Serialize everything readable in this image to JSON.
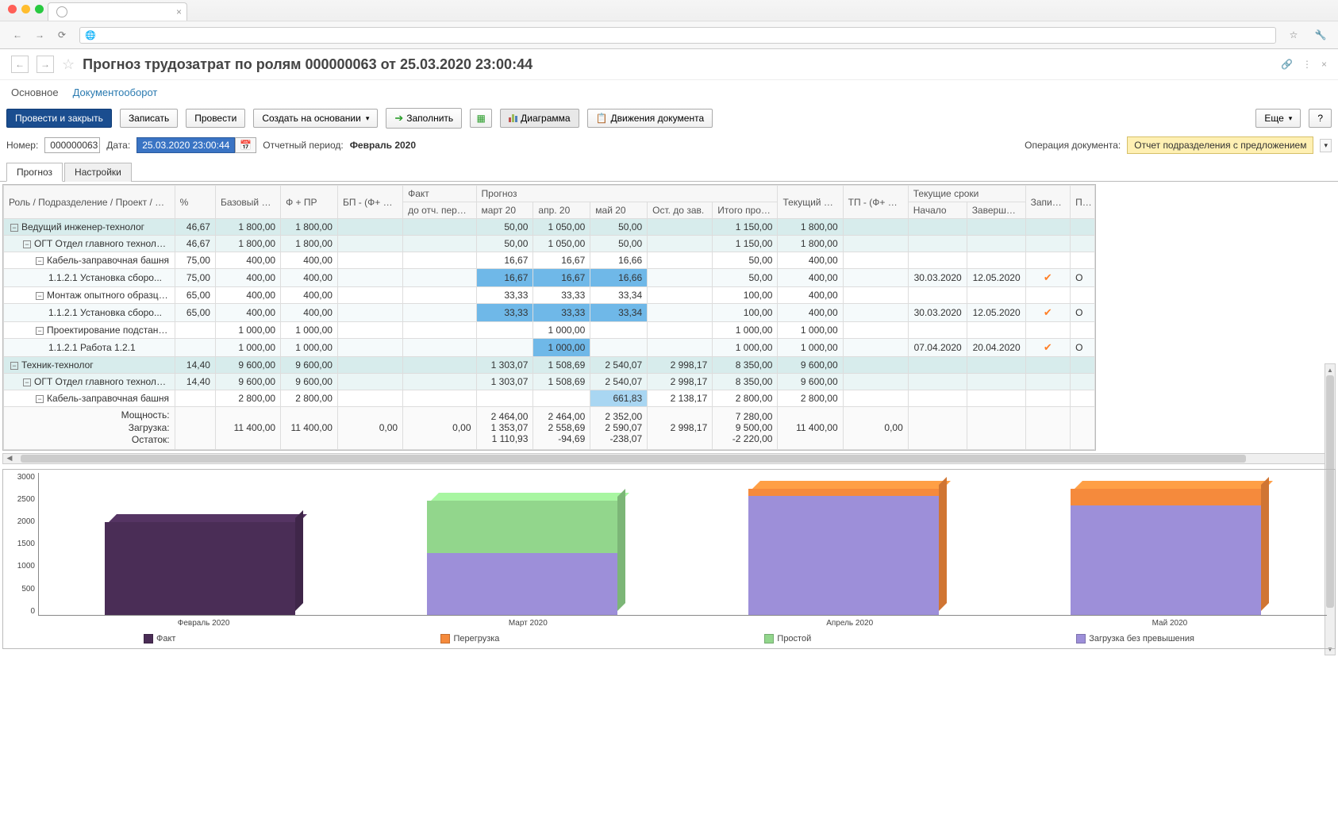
{
  "header": {
    "title": "Прогноз трудозатрат по ролям 000000063 от 25.03.2020 23:00:44"
  },
  "subnav": {
    "main": "Основное",
    "docs": "Документооборот"
  },
  "toolbar": {
    "post_close": "Провести и закрыть",
    "write": "Записать",
    "post": "Провести",
    "create_based": "Создать на основании",
    "fill": "Заполнить",
    "diagram": "Диаграмма",
    "movements": "Движения документа",
    "more": "Еще",
    "help": "?"
  },
  "fields": {
    "number_label": "Номер:",
    "number": "000000063",
    "date_label": "Дата:",
    "date": "25.03.2020 23:00:44",
    "period_label": "Отчетный период:",
    "period": "Февраль 2020",
    "operation_label": "Операция документа:",
    "operation": "Отчет подразделения с предложением"
  },
  "tabs": {
    "forecast": "Прогноз",
    "settings": "Настройки"
  },
  "columns": {
    "role": "Роль / Подразделение / Проект / Задача",
    "percent": "%",
    "base_plan": "Базовый план",
    "f_pr": "Ф + ПР",
    "bp_fpr": "БП - (Ф+ ПР)",
    "fact": "Факт",
    "fact_sub": "до отч. периода",
    "forecast_group": "Прогноз",
    "mar": "март 20",
    "apr": "апр. 20",
    "may": "май 20",
    "rest": "Ост. до зав.",
    "total_forecast": "Итого прогноз",
    "current_plan": "Текущий план",
    "tp_fpr": "ТП - (Ф+ ПР)",
    "dates_group": "Текущие сроки",
    "start": "Начало",
    "end": "Завершение",
    "write_col": "Записать",
    "pr_col": "Пр тр"
  },
  "rows": [
    {
      "lvl": 0,
      "name": "Ведущий инженер-технолог",
      "pct": "46,67",
      "bp": "1 800,00",
      "fpr": "1 800,00",
      "mar": "50,00",
      "apr": "1 050,00",
      "may": "50,00",
      "total": "1 150,00",
      "cur": "1 800,00"
    },
    {
      "lvl": 1,
      "name": "ОГТ Отдел главного технолога",
      "pct": "46,67",
      "bp": "1 800,00",
      "fpr": "1 800,00",
      "mar": "50,00",
      "apr": "1 050,00",
      "may": "50,00",
      "total": "1 150,00",
      "cur": "1 800,00"
    },
    {
      "lvl": 2,
      "name": "Кабель-заправочная башня",
      "pct": "75,00",
      "bp": "400,00",
      "fpr": "400,00",
      "mar": "16,67",
      "apr": "16,67",
      "may": "16,66",
      "total": "50,00",
      "cur": "400,00"
    },
    {
      "lvl": 3,
      "name": "1.1.2.1 Установка сборо...",
      "pct": "75,00",
      "bp": "400,00",
      "fpr": "400,00",
      "mar": "16,67",
      "apr": "16,67",
      "may": "16,66",
      "total": "50,00",
      "cur": "400,00",
      "hl": "blue",
      "start": "30.03.2020",
      "end": "12.05.2020",
      "check": true,
      "ext": "О"
    },
    {
      "lvl": 2,
      "name": "Монтаж опытного образца ...",
      "pct": "65,00",
      "bp": "400,00",
      "fpr": "400,00",
      "mar": "33,33",
      "apr": "33,33",
      "may": "33,34",
      "total": "100,00",
      "cur": "400,00"
    },
    {
      "lvl": 3,
      "name": "1.1.2.1 Установка сборо...",
      "pct": "65,00",
      "bp": "400,00",
      "fpr": "400,00",
      "mar": "33,33",
      "apr": "33,33",
      "may": "33,34",
      "total": "100,00",
      "cur": "400,00",
      "hl": "blue",
      "start": "30.03.2020",
      "end": "12.05.2020",
      "check": true,
      "ext": "О"
    },
    {
      "lvl": 2,
      "name": "Проектирование подстанции",
      "bp": "1 000,00",
      "fpr": "1 000,00",
      "apr": "1 000,00",
      "total": "1 000,00",
      "cur": "1 000,00"
    },
    {
      "lvl": 3,
      "name": "1.1.2.1 Работа 1.2.1",
      "bp": "1 000,00",
      "fpr": "1 000,00",
      "apr": "1 000,00",
      "total": "1 000,00",
      "cur": "1 000,00",
      "hl": "blue-apr",
      "start": "07.04.2020",
      "end": "20.04.2020",
      "check": true,
      "ext": "О"
    },
    {
      "lvl": 0,
      "name": "Техник-технолог",
      "pct": "14,40",
      "bp": "9 600,00",
      "fpr": "9 600,00",
      "mar": "1 303,07",
      "apr": "1 508,69",
      "may": "2 540,07",
      "rest": "2 998,17",
      "total": "8 350,00",
      "cur": "9 600,00"
    },
    {
      "lvl": 1,
      "name": "ОГТ Отдел главного технолога",
      "pct": "14,40",
      "bp": "9 600,00",
      "fpr": "9 600,00",
      "mar": "1 303,07",
      "apr": "1 508,69",
      "may": "2 540,07",
      "rest": "2 998,17",
      "total": "8 350,00",
      "cur": "9 600,00"
    },
    {
      "lvl": 2,
      "name": "Кабель-заправочная башня",
      "bp": "2 800,00",
      "fpr": "2 800,00",
      "may": "661,83",
      "rest": "2 138,17",
      "total": "2 800,00",
      "cur": "2 800,00",
      "hl": "lt-may"
    }
  ],
  "summary": {
    "labels": [
      "Мощность:",
      "Загрузка:",
      "Остаток:"
    ],
    "bp": "11 400,00",
    "fpr": "11 400,00",
    "bpfpr": "0,00",
    "fact": "0,00",
    "mar": [
      "2 464,00",
      "1 353,07",
      "1 110,93"
    ],
    "apr": [
      "2 464,00",
      "2 558,69",
      "-94,69"
    ],
    "may": [
      "2 352,00",
      "2 590,07",
      "-238,07"
    ],
    "rest": "2 998,17",
    "total": [
      "7 280,00",
      "9 500,00",
      "-2 220,00"
    ],
    "cur": "11 400,00",
    "tpfpr": "0,00"
  },
  "chart_data": {
    "type": "bar",
    "stacked": true,
    "ylim": [
      0,
      3000
    ],
    "yticks": [
      0,
      500,
      1000,
      1500,
      2000,
      2500,
      3000
    ],
    "categories": [
      "Февраль 2020",
      "Март 2020",
      "Апрель 2020",
      "Май 2020"
    ],
    "series": [
      {
        "name": "Факт",
        "color": "#4a2d56",
        "values": [
          1950,
          0,
          0,
          0
        ]
      },
      {
        "name": "Загрузка без превышения",
        "color": "#9d8fd9",
        "values": [
          0,
          1300,
          2500,
          2300
        ]
      },
      {
        "name": "Простой",
        "color": "#92d68c",
        "values": [
          0,
          1100,
          0,
          0
        ]
      },
      {
        "name": "Перегрузка",
        "color": "#f58a3c",
        "values": [
          0,
          0,
          150,
          350
        ]
      }
    ],
    "legend": [
      "Факт",
      "Перегрузка",
      "Простой",
      "Загрузка без превышения"
    ]
  },
  "colors": {
    "fact": "#4a2d56",
    "overload": "#f58a3c",
    "idle": "#92d68c",
    "load": "#9d8fd9"
  }
}
